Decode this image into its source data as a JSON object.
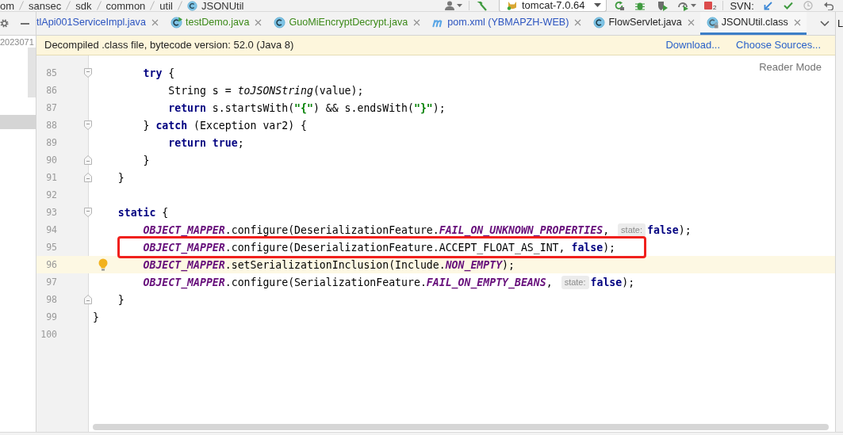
{
  "breadcrumb": [
    {
      "text": "om",
      "kind": "package"
    },
    {
      "text": "sansec",
      "kind": "package"
    },
    {
      "text": "sdk",
      "kind": "package"
    },
    {
      "text": "common",
      "kind": "package"
    },
    {
      "text": "util",
      "kind": "package"
    },
    {
      "text": "JSONUtil",
      "kind": "class"
    }
  ],
  "toolbar": {
    "run_config": "tomcat-7.0.64",
    "process_count": "2",
    "vcs_label": "SVN:"
  },
  "project_panel": {
    "tree_text": "2023071"
  },
  "tabs": [
    {
      "label": "tlApi001ServiceImpl.java",
      "kind": "text_only",
      "color": "#2d55c0",
      "selected": false
    },
    {
      "label": "testDemo.java",
      "kind": "class_runnable",
      "color": "#3d8a1a",
      "selected": false
    },
    {
      "label": "GuoMiEncryptDecrypt.java",
      "kind": "class",
      "color": "#3d8a1a",
      "selected": false
    },
    {
      "label": "pom.xml (YBMAPZH-WEB)",
      "kind": "maven",
      "color": "#2d55c0",
      "selected": false
    },
    {
      "label": "FlowServlet.java",
      "kind": "class",
      "color": "#1f1f1f",
      "selected": false
    },
    {
      "label": "JSONUtil.class",
      "kind": "class_locked",
      "color": "#1f1f1f",
      "selected": true
    }
  ],
  "banner": {
    "message": "Decompiled .class file, bytecode version: 52.0 (Java 8)",
    "actions": [
      "Download...",
      "Choose Sources..."
    ]
  },
  "editor": {
    "reader_mode": "Reader Mode",
    "lines": [
      {
        "number": "85",
        "fold_marker": {
          "kind": "start"
        },
        "current": false,
        "bulb": false,
        "boxed": false,
        "parts": [
          {
            "kind": "code",
            "tokens": [
              {
                "kind": "keyword",
                "text": "        try"
              },
              {
                "kind": "plain",
                "text": " {"
              }
            ]
          }
        ]
      },
      {
        "number": "86",
        "current": false,
        "bulb": false,
        "boxed": false,
        "parts": [
          {
            "kind": "code",
            "tokens": [
              {
                "kind": "plain",
                "text": "            String s = "
              },
              {
                "kind": "static_call",
                "text": "toJSONString"
              },
              {
                "kind": "plain",
                "text": "(value);"
              }
            ]
          }
        ]
      },
      {
        "number": "87",
        "current": false,
        "bulb": false,
        "boxed": false,
        "parts": [
          {
            "kind": "code",
            "tokens": [
              {
                "kind": "keyword",
                "text": "            return"
              },
              {
                "kind": "plain",
                "text": " s.startsWith("
              },
              {
                "kind": "string",
                "text": "\"{\""
              },
              {
                "kind": "plain",
                "text": ") && s.endsWith("
              },
              {
                "kind": "string",
                "text": "\"}\""
              },
              {
                "kind": "plain",
                "text": ");"
              }
            ]
          }
        ]
      },
      {
        "number": "88",
        "fold_marker": {
          "kind": "start"
        },
        "current": false,
        "bulb": false,
        "boxed": false,
        "parts": [
          {
            "kind": "code",
            "tokens": [
              {
                "kind": "plain",
                "text": "        } "
              },
              {
                "kind": "keyword",
                "text": "catch"
              },
              {
                "kind": "plain",
                "text": " (Exception var2) {"
              }
            ]
          }
        ]
      },
      {
        "number": "89",
        "current": false,
        "bulb": false,
        "boxed": false,
        "parts": [
          {
            "kind": "code",
            "tokens": [
              {
                "kind": "keyword",
                "text": "            return true"
              },
              {
                "kind": "plain",
                "text": ";"
              }
            ]
          }
        ]
      },
      {
        "number": "90",
        "fold_marker": {
          "kind": "end"
        },
        "current": false,
        "bulb": false,
        "boxed": false,
        "parts": [
          {
            "kind": "code",
            "tokens": [
              {
                "kind": "plain",
                "text": "        }"
              }
            ]
          }
        ]
      },
      {
        "number": "91",
        "fold_marker": {
          "kind": "end"
        },
        "current": false,
        "bulb": false,
        "boxed": false,
        "parts": [
          {
            "kind": "code",
            "tokens": [
              {
                "kind": "plain",
                "text": "    }"
              }
            ]
          }
        ]
      },
      {
        "number": "92",
        "current": false,
        "bulb": false,
        "boxed": false
      },
      {
        "number": "93",
        "fold_marker": {
          "kind": "start"
        },
        "current": false,
        "bulb": false,
        "boxed": false,
        "parts": [
          {
            "kind": "code",
            "tokens": [
              {
                "kind": "keyword",
                "text": "    static"
              },
              {
                "kind": "plain",
                "text": " {"
              }
            ]
          }
        ]
      },
      {
        "number": "94",
        "current": false,
        "bulb": false,
        "boxed": false,
        "parts": [
          {
            "kind": "code",
            "tokens": [
              {
                "kind": "field",
                "text": "        OBJECT_MAPPER"
              },
              {
                "kind": "plain",
                "text": ".configure(DeserializationFeature."
              },
              {
                "kind": "field",
                "text": "FAIL_ON_UNKNOWN_PROPERTIES"
              },
              {
                "kind": "plain",
                "text": ","
              }
            ]
          },
          {
            "kind": "hint",
            "text": "state:"
          },
          {
            "kind": "code",
            "tokens": [
              {
                "kind": "keyword",
                "text": "false"
              },
              {
                "kind": "plain",
                "text": ");"
              }
            ]
          }
        ]
      },
      {
        "number": "95",
        "current": false,
        "bulb": false,
        "boxed": true,
        "parts": [
          {
            "kind": "code",
            "tokens": [
              {
                "kind": "field",
                "text": "        OBJECT_MAPPER"
              },
              {
                "kind": "plain",
                "text": ".configure(DeserializationFeature.ACCEPT_FLOAT_AS_INT, "
              },
              {
                "kind": "keyword",
                "text": "false"
              },
              {
                "kind": "plain",
                "text": ");"
              }
            ]
          }
        ]
      },
      {
        "number": "96",
        "current": true,
        "bulb": true,
        "boxed": false,
        "parts": [
          {
            "kind": "code",
            "tokens": [
              {
                "kind": "field",
                "text": "        OBJECT_MAPPER"
              },
              {
                "kind": "plain",
                "text": ".setSerializationInclusion(Include."
              },
              {
                "kind": "field",
                "text": "NON_EMPTY"
              },
              {
                "kind": "plain",
                "text": ");"
              }
            ]
          }
        ]
      },
      {
        "number": "97",
        "current": false,
        "bulb": false,
        "boxed": false,
        "parts": [
          {
            "kind": "code",
            "tokens": [
              {
                "kind": "field",
                "text": "        OBJECT_MAPPER"
              },
              {
                "kind": "plain",
                "text": ".configure(SerializationFeature."
              },
              {
                "kind": "field",
                "text": "FAIL_ON_EMPTY_BEANS"
              },
              {
                "kind": "plain",
                "text": ","
              }
            ]
          },
          {
            "kind": "hint",
            "text": "state:"
          },
          {
            "kind": "code",
            "tokens": [
              {
                "kind": "keyword",
                "text": "false"
              },
              {
                "kind": "plain",
                "text": ");"
              }
            ]
          }
        ]
      },
      {
        "number": "98",
        "fold_marker": {
          "kind": "end"
        },
        "current": false,
        "bulb": false,
        "boxed": false,
        "parts": [
          {
            "kind": "code",
            "tokens": [
              {
                "kind": "plain",
                "text": "    }"
              }
            ]
          }
        ]
      },
      {
        "number": "99",
        "current": false,
        "bulb": false,
        "boxed": false,
        "parts": [
          {
            "kind": "code",
            "tokens": [
              {
                "kind": "plain",
                "text": "}"
              }
            ]
          }
        ]
      },
      {
        "number": "100",
        "current": false,
        "bulb": false,
        "boxed": false
      }
    ]
  },
  "right_strip": {
    "label": "L"
  }
}
